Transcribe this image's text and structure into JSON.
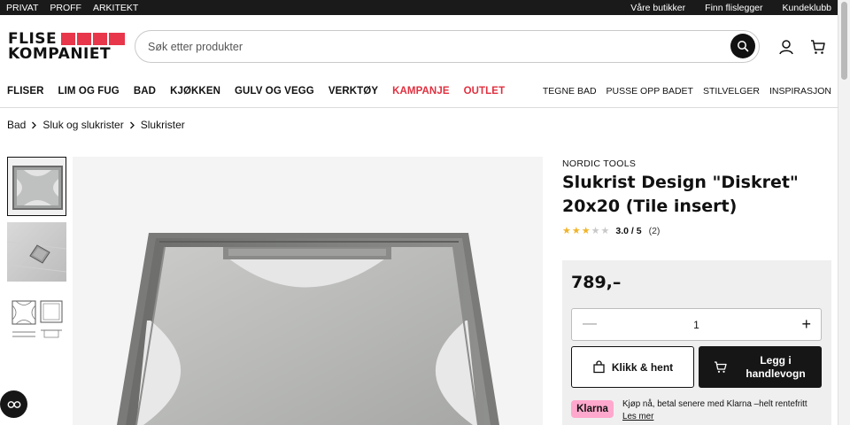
{
  "topbar": {
    "left": [
      "PRIVAT",
      "PROFF",
      "ARKITEKT"
    ],
    "right": [
      "Våre butikker",
      "Finn flislegger",
      "Kundeklubb"
    ]
  },
  "logo": {
    "line1": "FLISE",
    "line2": "KOMPANIET"
  },
  "search": {
    "placeholder": "Søk etter produkter"
  },
  "nav": {
    "main": [
      {
        "label": "FLISER",
        "highlight": false
      },
      {
        "label": "LIM OG FUG",
        "highlight": false
      },
      {
        "label": "BAD",
        "highlight": false
      },
      {
        "label": "KJØKKEN",
        "highlight": false
      },
      {
        "label": "GULV OG VEGG",
        "highlight": false
      },
      {
        "label": "VERKTØY",
        "highlight": false
      },
      {
        "label": "KAMPANJE",
        "highlight": true
      },
      {
        "label": "OUTLET",
        "highlight": true
      }
    ],
    "side": [
      "TEGNE BAD",
      "PUSSE OPP BADET",
      "STILVELGER",
      "INSPIRASJON"
    ]
  },
  "breadcrumb": [
    "Bad",
    "Sluk og slukrister",
    "Slukrister"
  ],
  "product": {
    "brand": "NORDIC TOOLS",
    "title": "Slukrist Design \"Diskret\" 20x20 (Tile insert)",
    "rating": {
      "score": "3.0 / 5",
      "count": "(2)",
      "stars_filled": 3,
      "stars_total": 5
    },
    "price": "789,–",
    "quantity": "1",
    "click_collect_label": "Klikk & hent",
    "add_to_cart_label": "Legg i handlevogn"
  },
  "klarna": {
    "badge": "Klarna",
    "text": "Kjøp nå, betal senere med Klarna –helt rentefritt",
    "link": "Les mer"
  },
  "colors": {
    "accent_red": "#e0303f",
    "logo_red": "#e8364a",
    "dark": "#161616",
    "klarna_pink": "#ffa8cd",
    "star": "#f0b429"
  }
}
